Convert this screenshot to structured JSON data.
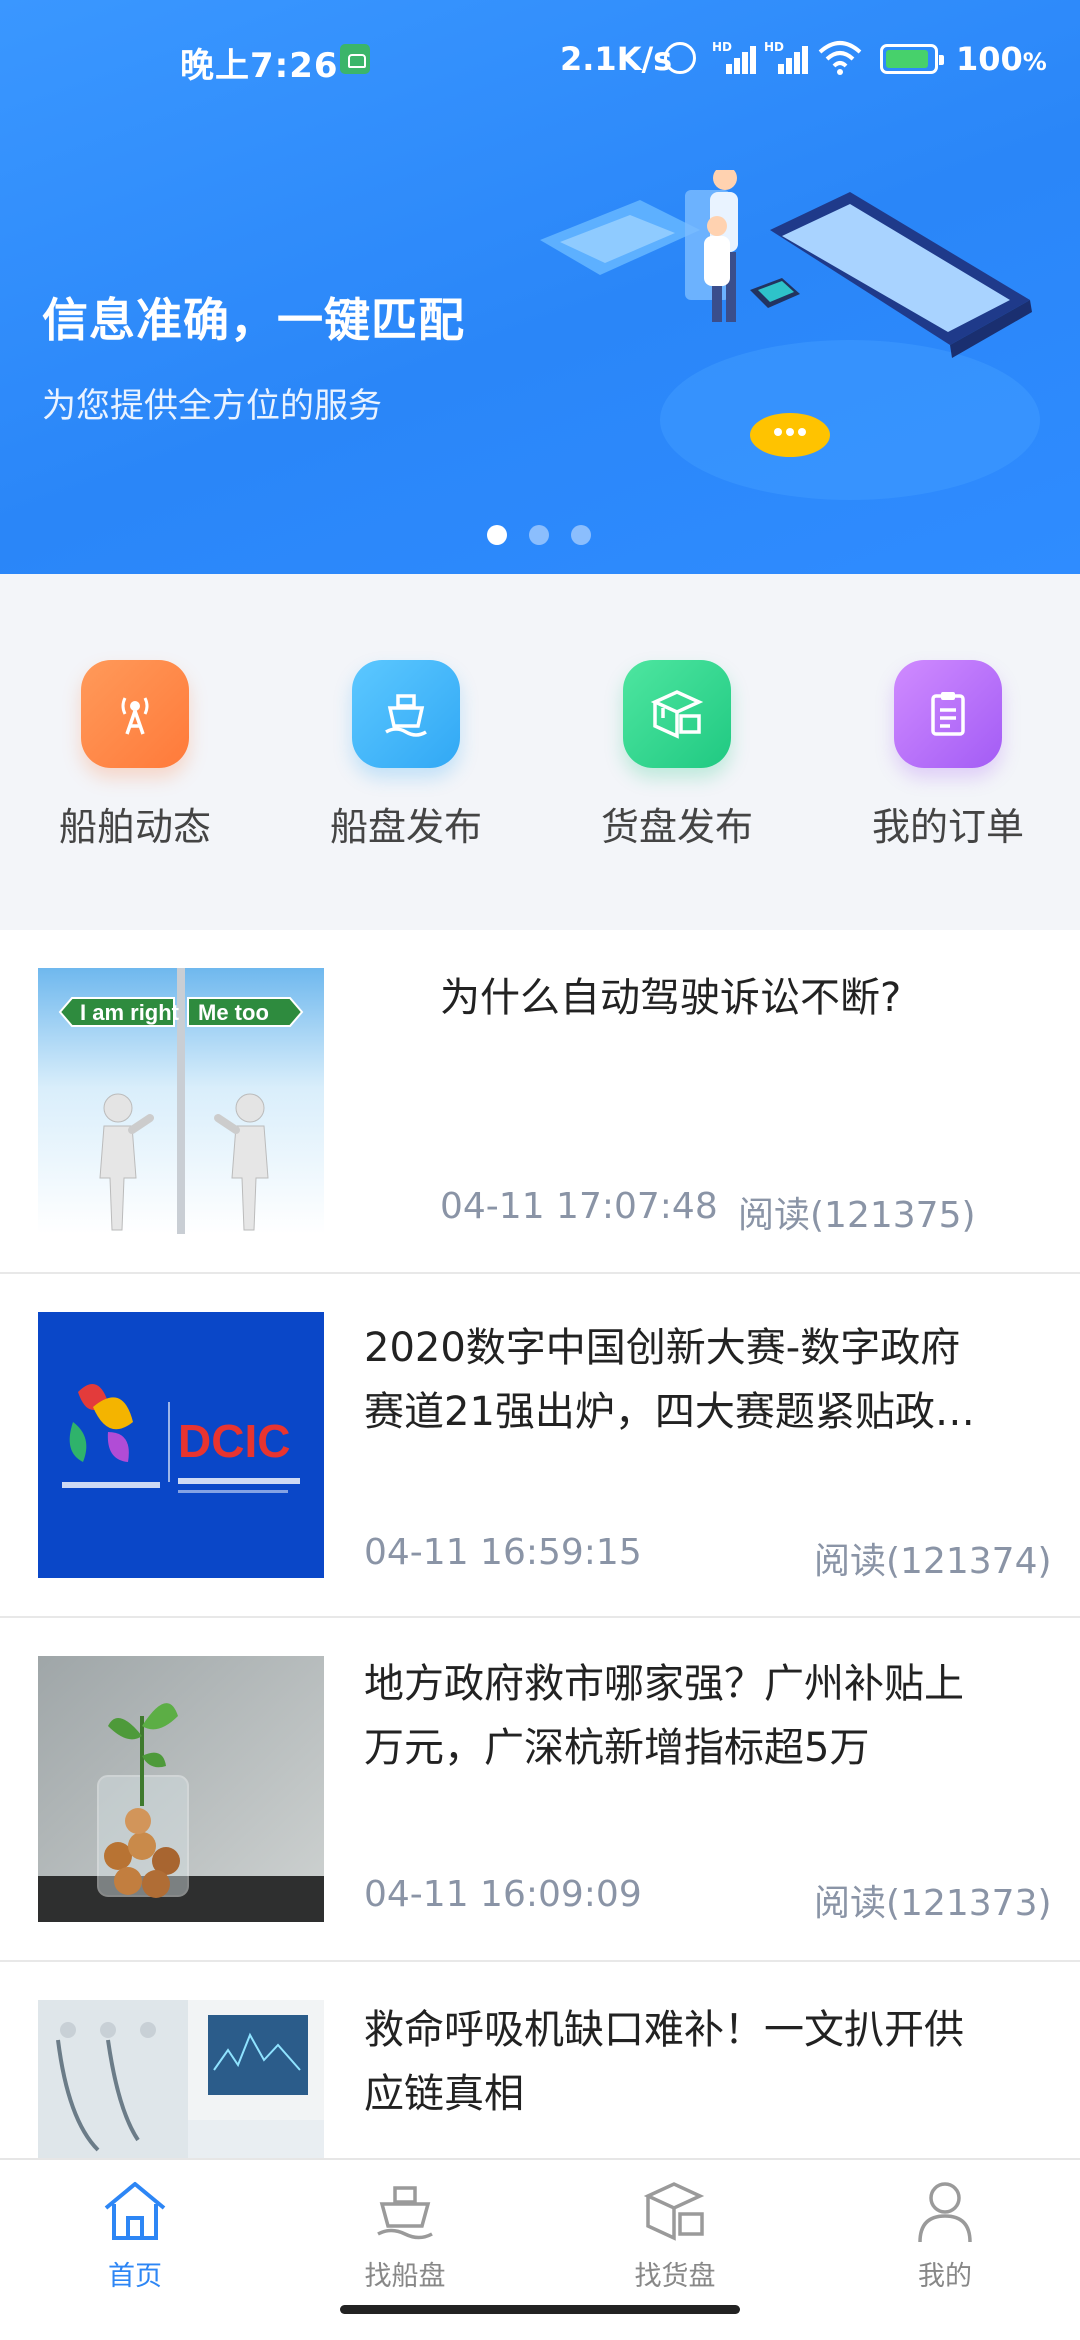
{
  "status_bar": {
    "time": "晚上7:26",
    "speed": "2.1K/s",
    "battery": "100",
    "battery_unit": "%"
  },
  "banner": {
    "title": "信息准确，一键匹配",
    "subtitle": "为您提供全方位的服务",
    "active_slide": 1,
    "slide_count": 3
  },
  "actions": [
    {
      "label": "船舶动态",
      "icon": "radio-tower-icon",
      "color": "#ff8a48"
    },
    {
      "label": "船盘发布",
      "icon": "ship-icon",
      "color": "#3fb4f7"
    },
    {
      "label": "货盘发布",
      "icon": "boxes-icon",
      "color": "#2dd58e"
    },
    {
      "label": "我的订单",
      "icon": "clipboard-icon",
      "color": "#b46ef8"
    }
  ],
  "news": [
    {
      "title": "为什么自动驾驶诉讼不断?",
      "date": "04-11 17:07:48",
      "reads": "阅读(121375)",
      "image": "signpost-figures-image",
      "sign_left": "I am right",
      "sign_right": "Me too"
    },
    {
      "title_line1": "2020数字中国创新大赛-数字政府",
      "title_line2": "赛道21强出炉，四大赛题紧贴政…",
      "date": "04-11 16:59:15",
      "reads": "阅读(121374)",
      "image": "dcic-contest-image",
      "logo_text": "DCIC"
    },
    {
      "title_line1": "地方政府救市哪家强？广州补贴上",
      "title_line2": "万元，广深杭新增指标超5万",
      "date": "04-11 16:09:09",
      "reads": "阅读(121373)",
      "image": "coins-plant-jar-image"
    },
    {
      "title_line1": "救命呼吸机缺口难补！一文扒开供",
      "title_line2": "应链真相",
      "image": "ventilator-image"
    }
  ],
  "tabs": [
    {
      "label": "首页",
      "icon": "home-icon",
      "active": true
    },
    {
      "label": "找船盘",
      "icon": "ship-icon",
      "active": false
    },
    {
      "label": "找货盘",
      "icon": "boxes-icon",
      "active": false
    },
    {
      "label": "我的",
      "icon": "user-icon",
      "active": false
    }
  ],
  "colors": {
    "accent": "#2d86f5",
    "banner": "#2f8cff",
    "muted_text": "#8a94a6"
  }
}
